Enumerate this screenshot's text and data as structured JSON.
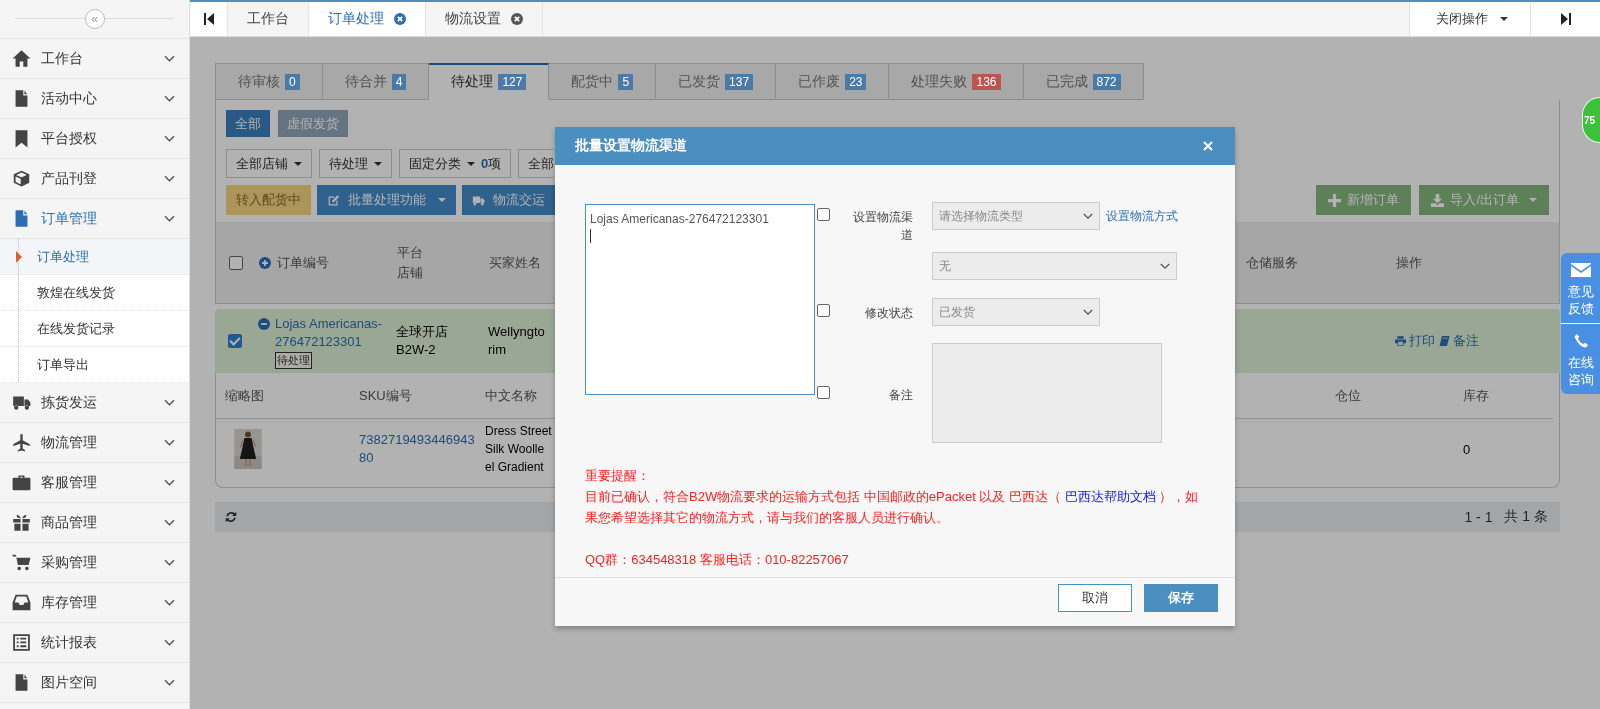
{
  "sidebar": {
    "collapse_glyph": "«",
    "items": [
      {
        "label": "工作台",
        "expanded": false
      },
      {
        "label": "活动中心",
        "expanded": false
      },
      {
        "label": "平台授权",
        "expanded": false
      },
      {
        "label": "产品刊登",
        "expanded": false
      },
      {
        "label": "订单管理",
        "expanded": true,
        "children": [
          {
            "label": "订单处理",
            "selected": true
          },
          {
            "label": "敦煌在线发货",
            "selected": false
          },
          {
            "label": "在线发货记录",
            "selected": false
          },
          {
            "label": "订单导出",
            "selected": false
          }
        ]
      },
      {
        "label": "拣货发运",
        "expanded": false
      },
      {
        "label": "物流管理",
        "expanded": false
      },
      {
        "label": "客服管理",
        "expanded": false
      },
      {
        "label": "商品管理",
        "expanded": false
      },
      {
        "label": "采购管理",
        "expanded": false
      },
      {
        "label": "库存管理",
        "expanded": false
      },
      {
        "label": "统计报表",
        "expanded": false
      },
      {
        "label": "图片空间",
        "expanded": false
      }
    ]
  },
  "top_tabs": [
    {
      "label": "工作台",
      "selected": false,
      "closable": false
    },
    {
      "label": "订单处理",
      "selected": true,
      "closable": true
    },
    {
      "label": "物流设置",
      "selected": false,
      "closable": true
    }
  ],
  "close_menu": "关闭操作",
  "order_tabs": [
    {
      "label": "待审核",
      "count": "0",
      "selected": false,
      "color": "#4a7aa8"
    },
    {
      "label": "待合并",
      "count": "4",
      "selected": false,
      "color": "#4a7aa8"
    },
    {
      "label": "待处理",
      "count": "127",
      "selected": true,
      "color": "#4a7aa8"
    },
    {
      "label": "配货中",
      "count": "5",
      "selected": false,
      "color": "#4a7aa8"
    },
    {
      "label": "已发货",
      "count": "137",
      "selected": false,
      "color": "#4a7aa8"
    },
    {
      "label": "已作废",
      "count": "23",
      "selected": false,
      "color": "#4a7aa8"
    },
    {
      "label": "处理失败",
      "count": "136",
      "selected": false,
      "color": "#b8564f"
    },
    {
      "label": "已完成",
      "count": "872",
      "selected": false,
      "color": "#4a7aa8"
    }
  ],
  "filter_buttons": [
    {
      "label": "全部",
      "selected": true
    },
    {
      "label": "虚假发货",
      "selected": false
    }
  ],
  "dropdowns": [
    {
      "label": "全部店铺"
    },
    {
      "label": "待处理"
    },
    {
      "label": "固定分类",
      "count": "0",
      "unit": "项"
    }
  ],
  "cut_dropdown": "全部",
  "actions": [
    {
      "label": "转入配货中",
      "kind": "warning"
    },
    {
      "label": "批量处理功能",
      "kind": "batch"
    },
    {
      "label": "物流交运",
      "kind": "ship"
    }
  ],
  "right_actions": [
    {
      "label": "新增订单",
      "kind": "add"
    },
    {
      "label": "导入/出订单",
      "kind": "import"
    }
  ],
  "order_table": {
    "checked": false,
    "columns": [
      "订单编号",
      "平台店铺",
      "买家姓名",
      "仓储服务",
      "操作"
    ],
    "row": {
      "checked": true,
      "order_no": "Lojas Americanas-276472123301",
      "status": "待处理",
      "shop": "全球开店B2W-2",
      "buyer_lines": [
        "Wellyngto",
        "rim"
      ],
      "links": [
        {
          "label": "打印",
          "kind": "print"
        },
        {
          "label": "备注",
          "kind": "note"
        }
      ]
    }
  },
  "items_table": {
    "columns": [
      "缩略图",
      "SKU编号",
      "中文名称",
      "仓位",
      "库存"
    ],
    "row": {
      "sku": "738271949344694380",
      "name_lines": [
        "Dress Street",
        "Silk Woolle",
        "el Gradient"
      ],
      "stock": "0"
    }
  },
  "pager": {
    "range": "1 - 1",
    "total": "共 1 条"
  },
  "count_badge": "75",
  "side_widget": [
    {
      "label": "意见反馈",
      "kind": "mail"
    },
    {
      "label": "在线咨询",
      "kind": "phone"
    }
  ],
  "modal": {
    "title": "批量设置物流渠道",
    "order_list": "Lojas Americanas-276472123301",
    "channel": {
      "label": "设置物流渠道",
      "checked": false,
      "select": "请选择物流类型",
      "link": "设置物流方式",
      "sub_select": "无"
    },
    "status": {
      "label": "修改状态",
      "checked": false,
      "select": "已发货"
    },
    "note": {
      "label": "备注",
      "checked": false
    },
    "notice": {
      "title": "重要提醒：",
      "before": "目前已确认，符合B2W物流要求的运输方式包括 中国邮政的ePacket 以及 巴西达（ ",
      "link": "巴西达帮助文档",
      "after": " ），如果您希望选择其它的物流方式，请与我们的客服人员进行确认。",
      "contact": "QQ群：634548318 客服电话：010-82257067"
    },
    "buttons": [
      {
        "label": "取消",
        "kind": "secondary"
      },
      {
        "label": "保存",
        "kind": "primary"
      }
    ]
  }
}
